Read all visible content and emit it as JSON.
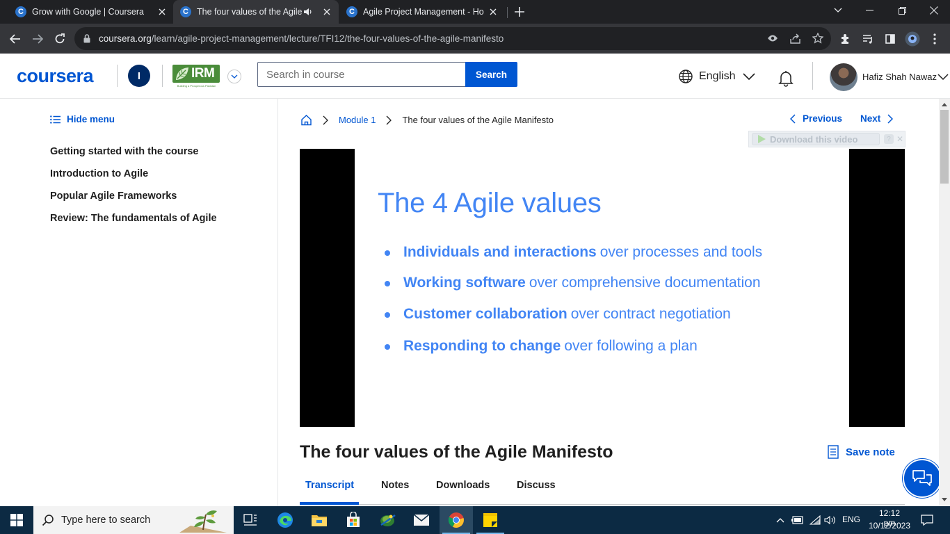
{
  "browser": {
    "tabs": [
      {
        "title": "Grow with Google | Coursera",
        "favicon": "C"
      },
      {
        "title": "The four values of the Agile",
        "favicon": "C"
      },
      {
        "title": "Agile Project Management - Ho",
        "favicon": "C"
      }
    ],
    "url_host": "coursera.org",
    "url_path": "/learn/agile-project-management/lecture/TFI12/the-four-values-of-the-agile-manifesto"
  },
  "header": {
    "logo": "coursera",
    "org_initial": "I",
    "partner_logo": "IRM",
    "partner_tagline": "Building a Prosperous Pakistan",
    "search_placeholder": "Search in course",
    "search_button": "Search",
    "language": "English",
    "user_name": "Hafiz Shah Nawaz"
  },
  "sidebar": {
    "hide_menu": "Hide menu",
    "items": [
      {
        "label": "Getting started with the course"
      },
      {
        "label": "Introduction to Agile"
      },
      {
        "label": "Popular Agile Frameworks"
      },
      {
        "label": "Review: The fundamentals of Agile"
      }
    ]
  },
  "main": {
    "breadcrumb": {
      "module": "Module 1",
      "current": "The four values of the Agile Manifesto"
    },
    "previous": "Previous",
    "next": "Next",
    "download_video": "Download this video",
    "slide": {
      "title": "The 4 Agile values",
      "values": [
        {
          "bold": "Individuals and interactions",
          "rest": "over processes and tools"
        },
        {
          "bold": "Working software",
          "rest": "over comprehensive documentation"
        },
        {
          "bold": "Customer collaboration",
          "rest": "over contract negotiation"
        },
        {
          "bold": "Responding to change",
          "rest": "over following a plan"
        }
      ]
    },
    "lecture_title": "The four values of the Agile Manifesto",
    "save_note": "Save note",
    "tabs": [
      {
        "label": "Transcript"
      },
      {
        "label": "Notes"
      },
      {
        "label": "Downloads"
      },
      {
        "label": "Discuss"
      }
    ]
  },
  "taskbar": {
    "search_placeholder": "Type here to search",
    "language": "ENG",
    "time": "12:12 pm",
    "date": "10/12/2023"
  },
  "colors": {
    "accent": "#0056d2",
    "slide_blue": "#4285f4",
    "taskbar": "#0c2a43"
  }
}
